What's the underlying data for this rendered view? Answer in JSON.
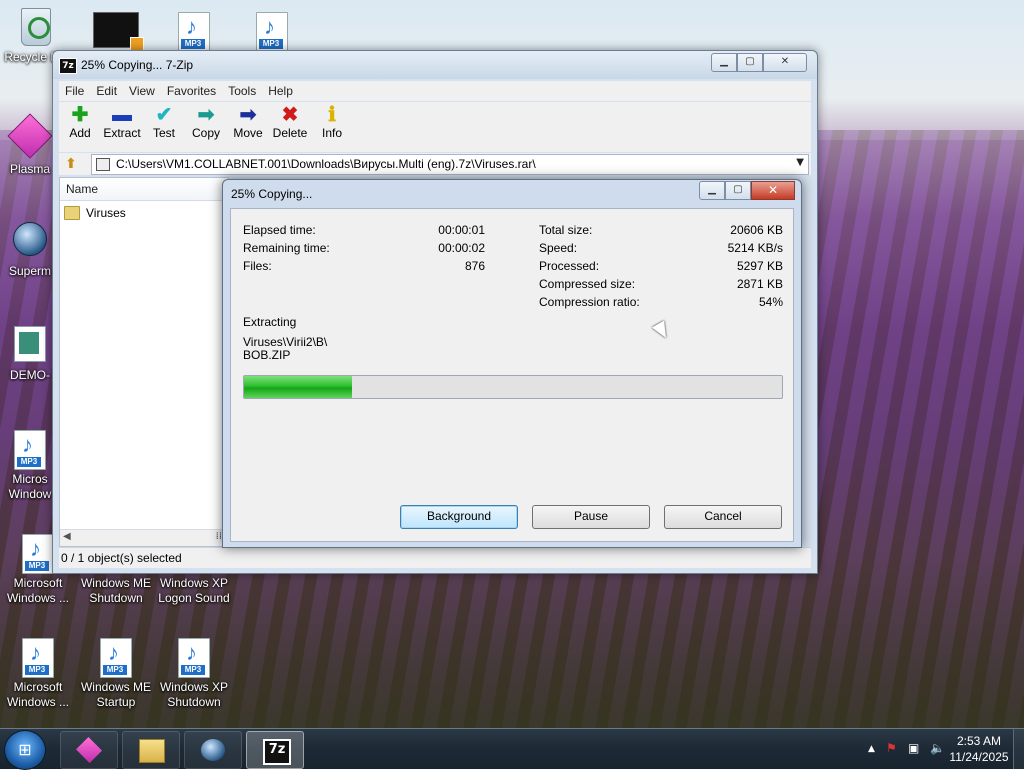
{
  "desktop": {
    "icons": [
      {
        "label": "Recycle Bin",
        "type": "recycle"
      },
      {
        "label": "",
        "type": "video"
      },
      {
        "label": "",
        "type": "mp3"
      },
      {
        "label": "",
        "type": "mp3"
      },
      {
        "label": "Plasma",
        "type": "plasma"
      },
      {
        "label": "Superm",
        "type": "superm"
      },
      {
        "label": "DEMO-",
        "type": "doc"
      },
      {
        "label": "Micros Window",
        "type": "mp3"
      },
      {
        "label": "Microsoft Windows ...",
        "type": "mp3"
      },
      {
        "label": "Windows ME Shutdown",
        "type": "mp3"
      },
      {
        "label": "Windows XP Logon Sound",
        "type": "mp3"
      },
      {
        "label": "Microsoft Windows ...",
        "type": "mp3"
      },
      {
        "label": "Windows ME Startup",
        "type": "mp3"
      },
      {
        "label": "Windows XP Shutdown",
        "type": "mp3"
      }
    ]
  },
  "window": {
    "title": "25% Copying... 7-Zip",
    "menu": [
      "File",
      "Edit",
      "View",
      "Favorites",
      "Tools",
      "Help"
    ],
    "toolbar": [
      {
        "label": "Add",
        "icon": "plus-icon",
        "color": "#1aa31a",
        "glyph": "✚"
      },
      {
        "label": "Extract",
        "icon": "minus-icon",
        "color": "#1a3fb8",
        "glyph": "▬"
      },
      {
        "label": "Test",
        "icon": "check-icon",
        "color": "#1fb5c4",
        "glyph": "✔"
      },
      {
        "label": "Copy",
        "icon": "copy-arrow-icon",
        "color": "#1b9a8f",
        "glyph": "➡"
      },
      {
        "label": "Move",
        "icon": "move-arrow-icon",
        "color": "#1a2f9a",
        "glyph": "➡"
      },
      {
        "label": "Delete",
        "icon": "delete-x-icon",
        "color": "#d11a1a",
        "glyph": "✖"
      },
      {
        "label": "Info",
        "icon": "info-icon",
        "color": "#d8b400",
        "glyph": "ℹ"
      }
    ],
    "address": "C:\\Users\\VM1.COLLABNET.001\\Downloads\\Вирусы.Multi (eng).7z\\Viruses.rar\\",
    "column_name": "Name",
    "rows": [
      "Viruses"
    ],
    "status": "0 / 1 object(s) selected"
  },
  "dialog": {
    "title": "25% Copying...",
    "left": [
      {
        "label": "Elapsed time:",
        "value": "00:00:01"
      },
      {
        "label": "Remaining time:",
        "value": "00:00:02"
      },
      {
        "label": "Files:",
        "value": "876"
      }
    ],
    "right": [
      {
        "label": "Total size:",
        "value": "20606 KB"
      },
      {
        "label": "Speed:",
        "value": "5214 KB/s"
      },
      {
        "label": "Processed:",
        "value": "5297 KB"
      },
      {
        "label": "Compressed size:",
        "value": "2871 KB"
      },
      {
        "label": "Compression ratio:",
        "value": "54%"
      }
    ],
    "operation": "Extracting",
    "path_line1": "Viruses\\Virii2\\B\\",
    "path_line2": "BOB.ZIP",
    "progress_fraction": 0.2,
    "buttons": {
      "background": "Background",
      "pause": "Pause",
      "cancel": "Cancel"
    }
  },
  "taskbar": {
    "time": "2:53 AM",
    "date": "11/24/2025"
  }
}
